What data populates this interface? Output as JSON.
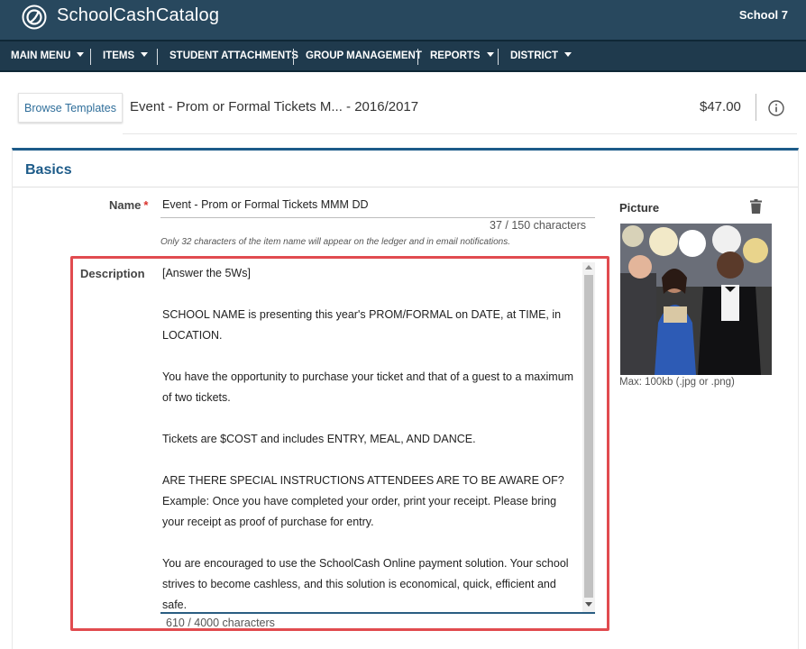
{
  "header": {
    "app_title": "SchoolCashCatalog",
    "school": "School 7"
  },
  "nav": {
    "items": [
      {
        "label": "MAIN MENU",
        "has_dropdown": true
      },
      {
        "label": "ITEMS",
        "has_dropdown": true
      },
      {
        "label": "STUDENT ATTACHMENTS",
        "has_dropdown": false
      },
      {
        "label": "GROUP MANAGEMENT",
        "has_dropdown": false
      },
      {
        "label": "REPORTS",
        "has_dropdown": true
      },
      {
        "label": "DISTRICT",
        "has_dropdown": true
      }
    ]
  },
  "template_bar": {
    "browse_label": "Browse Templates",
    "item_title": "Event - Prom or Formal Tickets M...  - 2016/2017",
    "price": "$47.00",
    "info_icon": "info-icon"
  },
  "basics": {
    "heading": "Basics",
    "name": {
      "label": "Name",
      "required_mark": "*",
      "value": "Event - Prom or Formal Tickets MMM DD",
      "count": "37  /  150   characters",
      "hint": "Only 32 characters of the item name will appear on the ledger and in email notifications."
    },
    "picture": {
      "label": "Picture",
      "delete_icon": "trash-icon",
      "hint": "Max: 100kb (.jpg or .png)"
    },
    "description": {
      "label": "Description",
      "paragraphs": [
        "[Answer the 5Ws]",
        "",
        "SCHOOL NAME is presenting this year's PROM/FORMAL  on DATE, at TIME, in LOCATION.",
        "",
        "You have the opportunity to purchase your ticket and that of a guest to a maximum of two tickets.",
        "",
        "Tickets are $COST and includes ENTRY, MEAL, AND DANCE.",
        "",
        "ARE THERE SPECIAL INSTRUCTIONS ATTENDEES ARE TO BE AWARE OF? Example: Once you have completed your order, print your receipt. Please bring your receipt as proof of purchase for entry.",
        "",
        "You are encouraged to use the SchoolCash Online payment solution. Your school strives to become cashless, and this solution is economical, quick, efficient and safe."
      ],
      "count": "610  /  4000   characters"
    }
  },
  "colors": {
    "header_bg": "#28485e",
    "nav_bg": "#1f3a4d",
    "accent": "#1d5b89",
    "highlight": "#e14b4f",
    "required": "#d9312b"
  }
}
